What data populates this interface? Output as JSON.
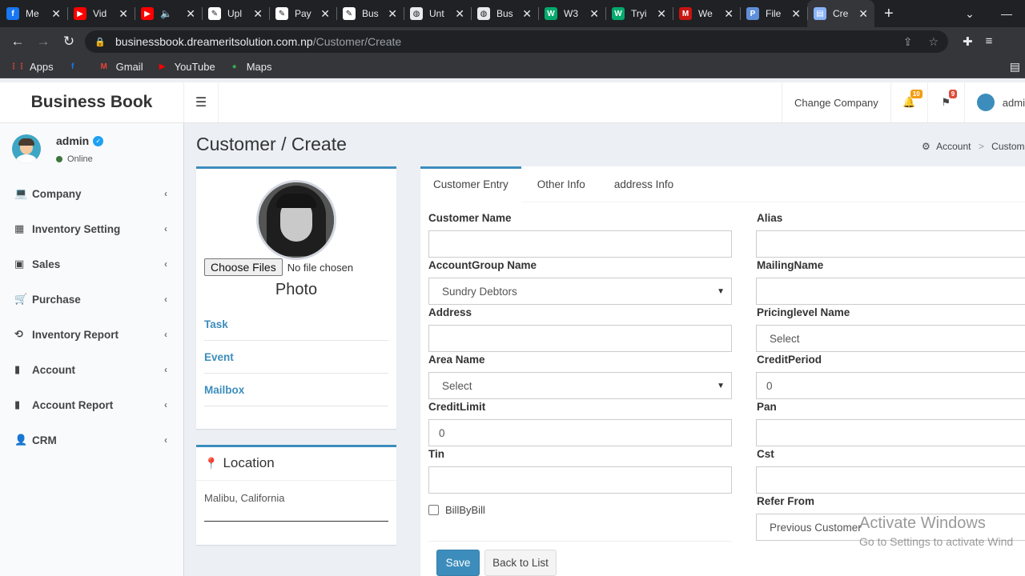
{
  "browser": {
    "tabs": [
      {
        "title": "Me",
        "favicon_color": "#1877f2",
        "favicon_glyph": "f"
      },
      {
        "title": "Vid",
        "favicon_color": "#ff0000",
        "favicon_glyph": "▶"
      },
      {
        "title": "",
        "favicon_color": "#ff0000",
        "favicon_glyph": "▶",
        "audio": "🔈"
      },
      {
        "title": "Upl",
        "favicon_color": "#ffffff",
        "favicon_glyph": "✎"
      },
      {
        "title": "Pay",
        "favicon_color": "#ffffff",
        "favicon_glyph": "✎"
      },
      {
        "title": "Bus",
        "favicon_color": "#ffffff",
        "favicon_glyph": "✎"
      },
      {
        "title": "Unt",
        "favicon_color": "#e8eaed",
        "favicon_glyph": "◍"
      },
      {
        "title": "Bus",
        "favicon_color": "#e8eaed",
        "favicon_glyph": "◍"
      },
      {
        "title": "W3",
        "favicon_color": "#04aa6d",
        "favicon_glyph": "W"
      },
      {
        "title": "Tryi",
        "favicon_color": "#04aa6d",
        "favicon_glyph": "W"
      },
      {
        "title": "We",
        "favicon_color": "#c71610",
        "favicon_glyph": "M"
      },
      {
        "title": "File",
        "favicon_color": "#5f8fd8",
        "favicon_glyph": "P"
      },
      {
        "title": "Cre",
        "favicon_color": "#8ab4f8",
        "favicon_glyph": "▤"
      }
    ],
    "url_host": "businessbook.dreameritsolution.com.np",
    "url_path": "/Customer/Create",
    "bookmarks": [
      {
        "label": "Apps",
        "color": "#ea4335",
        "glyph": "⋮⋮"
      },
      {
        "label": "",
        "color": "#1877f2",
        "glyph": "f"
      },
      {
        "label": "Gmail",
        "color": "#ea4335",
        "glyph": "M"
      },
      {
        "label": "YouTube",
        "color": "#ff0000",
        "glyph": "▶"
      },
      {
        "label": "Maps",
        "color": "#34a853",
        "glyph": "●"
      }
    ]
  },
  "header": {
    "brand": "Business Book",
    "change_company": "Change Company",
    "notifications_count": "10",
    "flags_count": "9",
    "user_label": "admi"
  },
  "sidebar": {
    "user_name": "admin",
    "status": "Online",
    "items": [
      {
        "label": "Company",
        "icon": "laptop-icon",
        "glyph": "💻"
      },
      {
        "label": "Inventory Setting",
        "icon": "grid-icon",
        "glyph": "▦"
      },
      {
        "label": "Sales",
        "icon": "file-invoice-icon",
        "glyph": "▣"
      },
      {
        "label": "Purchase",
        "icon": "cart-icon",
        "glyph": "🛒"
      },
      {
        "label": "Inventory Report",
        "icon": "history-icon",
        "glyph": "⟲"
      },
      {
        "label": "Account",
        "icon": "book-icon",
        "glyph": "▮"
      },
      {
        "label": "Account Report",
        "icon": "report-icon",
        "glyph": "▮"
      },
      {
        "label": "CRM",
        "icon": "user-cog-icon",
        "glyph": "👤"
      }
    ]
  },
  "content": {
    "title": "Customer / Create",
    "breadcrumb": [
      "Account",
      "Customer"
    ]
  },
  "profile": {
    "choose_files": "Choose Files",
    "no_file": "No file chosen",
    "photo_label": "Photo",
    "links": [
      "Task",
      "Event",
      "Mailbox"
    ]
  },
  "location": {
    "title": "Location",
    "text": "Malibu, California"
  },
  "form": {
    "tabs": [
      "Customer Entry",
      "Other Info",
      "address Info"
    ],
    "left": {
      "customer_name_label": "Customer Name",
      "customer_name_value": "",
      "account_group_label": "AccountGroup Name",
      "account_group_value": "Sundry Debtors",
      "address_label": "Address",
      "address_value": "",
      "area_label": "Area Name",
      "area_value": "Select",
      "credit_limit_label": "CreditLimit",
      "credit_limit_value": "0",
      "tin_label": "Tin",
      "tin_value": "",
      "billbybill_label": "BillByBill"
    },
    "right": {
      "alias_label": "Alias",
      "alias_value": "",
      "mailing_label": "MailingName",
      "mailing_value": "",
      "pricing_label": "Pricinglevel Name",
      "pricing_value": "Select",
      "credit_period_label": "CreditPeriod",
      "credit_period_value": "0",
      "pan_label": "Pan",
      "pan_value": "",
      "cst_label": "Cst",
      "cst_value": "",
      "refer_label": "Refer From",
      "refer_value": "Previous Customer"
    },
    "save": "Save",
    "back": "Back to List"
  },
  "watermark": {
    "line1": "Activate Windows",
    "line2": "Go to Settings to activate Wind"
  }
}
